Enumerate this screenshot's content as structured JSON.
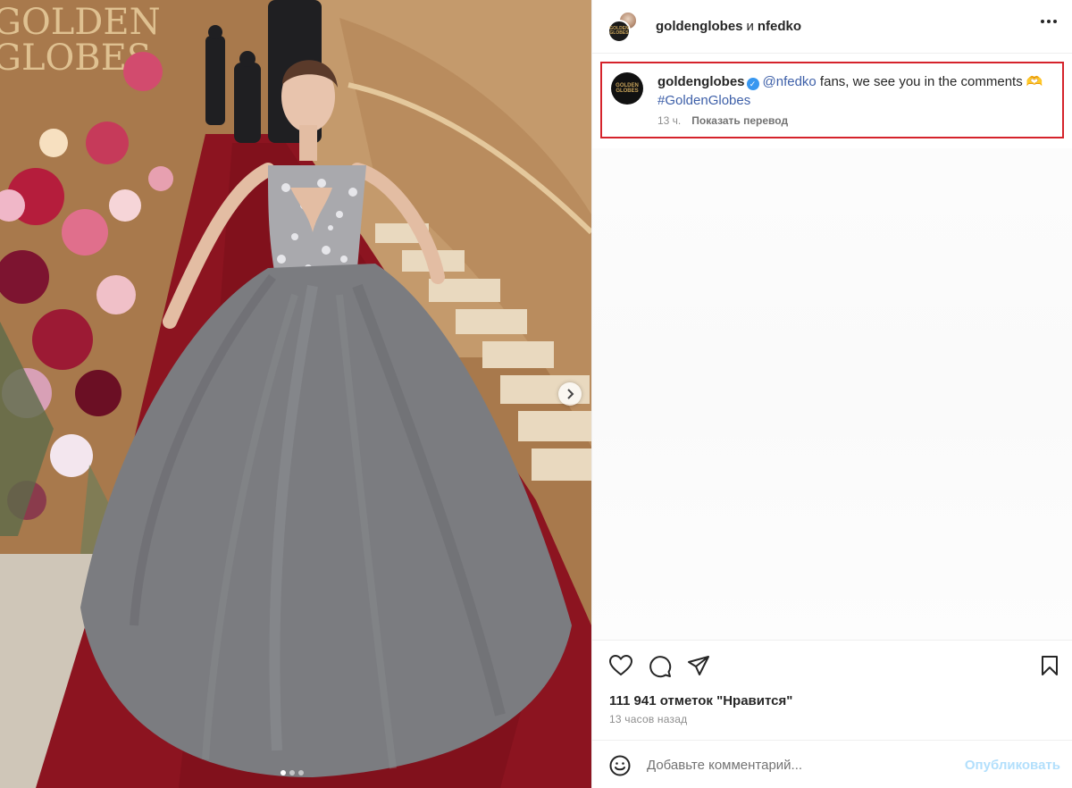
{
  "post": {
    "header": {
      "user_primary": "goldenglobes",
      "conjunction": "и",
      "user_secondary": "nfedko"
    },
    "logo_text": [
      "GOLDEN",
      "GLOBES"
    ],
    "photo": {
      "background_text": [
        "GOLDEN",
        "GLOBES"
      ],
      "carousel_total": 3,
      "carousel_active": 1
    },
    "caption": {
      "username": "goldenglobes",
      "mention": "@nfedko",
      "text": " fans, we see you in the comments 🫶",
      "hashtag": "#GoldenGlobes",
      "time": "13 ч.",
      "translate_label": "Показать перевод"
    },
    "likes": "111 941 отметок \"Нравится\"",
    "time_ago": "13 часов назад",
    "comment": {
      "placeholder": "Добавьте комментарий...",
      "post_label": "Опубликовать"
    },
    "colors": {
      "highlight_border": "#d5232b",
      "verified_badge": "#3897f0",
      "link": "#00376b",
      "post_button_disabled": "#b2dffc"
    }
  }
}
